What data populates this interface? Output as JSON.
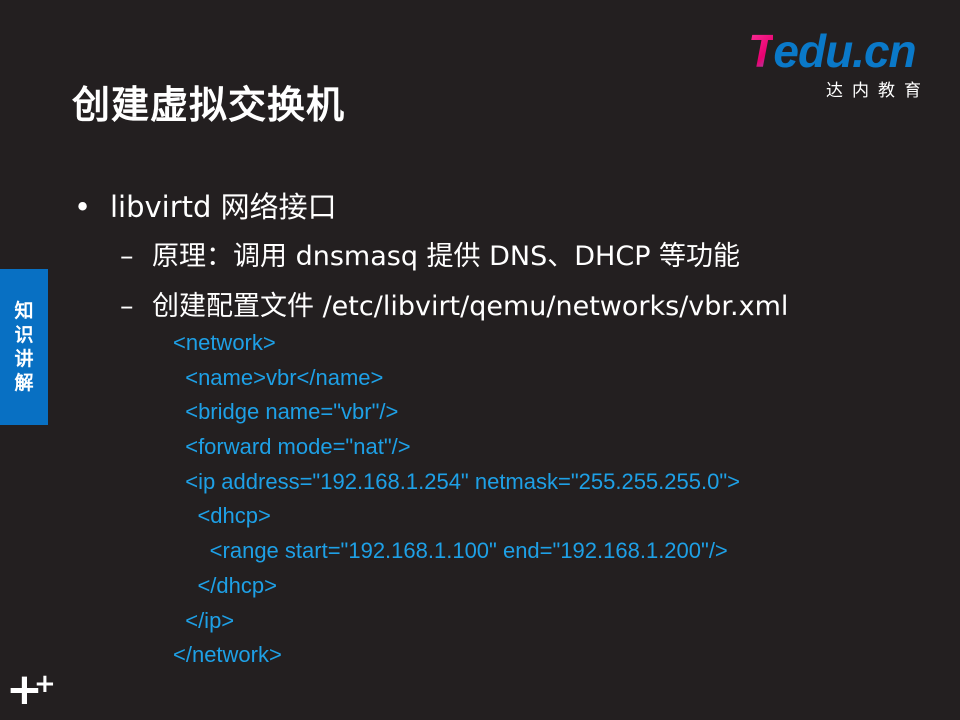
{
  "title": "创建虚拟交换机",
  "logo": {
    "brand_t": "T",
    "brand_rest": "edu.cn",
    "subtitle": "达内教育"
  },
  "side_tab": {
    "chars": [
      "知",
      "识",
      "讲",
      "解"
    ]
  },
  "bullet": {
    "marker": "•",
    "text": "libvirtd 网络接口"
  },
  "subbullets": [
    {
      "marker": "–",
      "text": "原理：调用 dnsmasq 提供 DNS、DHCP 等功能"
    },
    {
      "marker": "–",
      "text": "创建配置文件 /etc/libvirt/qemu/networks/vbr.xml"
    }
  ],
  "code_lines": [
    "<network>",
    "  <name>vbr</name>",
    "  <bridge name=\"vbr\"/>",
    "  <forward mode=\"nat\"/>",
    "  <ip address=\"192.168.1.254\" netmask=\"255.255.255.0\">",
    "    <dhcp>",
    "      <range start=\"192.168.1.100\" end=\"192.168.1.200\"/>",
    "    </dhcp>",
    "  </ip>",
    "</network>"
  ],
  "footer": {
    "plus_big": "+",
    "plus_small": "+"
  }
}
